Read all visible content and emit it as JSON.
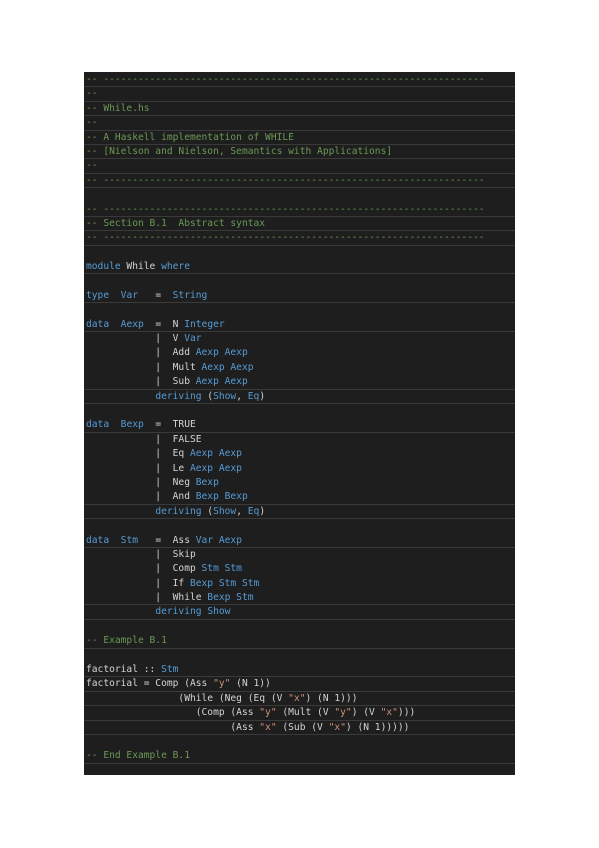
{
  "colors": {
    "background": "#1e1e1e",
    "comment": "#6a9955",
    "keyword": "#569cd6",
    "string": "#ce9178",
    "text": "#d4d4d4"
  },
  "lines": [
    [
      {
        "t": "-- ------------------------------------------------------------------",
        "k": "comment"
      }
    ],
    [
      {
        "t": "--",
        "k": "comment"
      }
    ],
    [
      {
        "t": "-- While.hs",
        "k": "comment"
      }
    ],
    [
      {
        "t": "--",
        "k": "comment"
      }
    ],
    [
      {
        "t": "-- A Haskell implementation of WHILE",
        "k": "comment"
      }
    ],
    [
      {
        "t": "-- [Nielson and Nielson, Semantics with Applications]",
        "k": "comment"
      }
    ],
    [
      {
        "t": "--",
        "k": "comment"
      }
    ],
    [
      {
        "t": "-- ------------------------------------------------------------------",
        "k": "comment"
      }
    ],
    [],
    [
      {
        "t": "-- ------------------------------------------------------------------",
        "k": "comment"
      }
    ],
    [
      {
        "t": "-- Section B.1  Abstract syntax",
        "k": "comment"
      }
    ],
    [
      {
        "t": "-- ------------------------------------------------------------------",
        "k": "comment"
      }
    ],
    [],
    [
      {
        "t": "module",
        "k": "keyword"
      },
      {
        "t": " While ",
        "k": "plain"
      },
      {
        "t": "where",
        "k": "keyword"
      }
    ],
    [],
    [
      {
        "t": "type",
        "k": "keyword"
      },
      {
        "t": "  ",
        "k": "plain"
      },
      {
        "t": "Var",
        "k": "keyword"
      },
      {
        "t": "   =  ",
        "k": "plain"
      },
      {
        "t": "String",
        "k": "keyword"
      }
    ],
    [],
    [
      {
        "t": "data",
        "k": "keyword"
      },
      {
        "t": "  ",
        "k": "plain"
      },
      {
        "t": "Aexp",
        "k": "keyword"
      },
      {
        "t": "  =  N ",
        "k": "plain"
      },
      {
        "t": "Integer",
        "k": "keyword"
      }
    ],
    [
      {
        "t": "            |  V ",
        "k": "plain"
      },
      {
        "t": "Var",
        "k": "keyword"
      }
    ],
    [
      {
        "t": "            |  Add ",
        "k": "plain"
      },
      {
        "t": "Aexp Aexp",
        "k": "keyword"
      }
    ],
    [
      {
        "t": "            |  Mult ",
        "k": "plain"
      },
      {
        "t": "Aexp Aexp",
        "k": "keyword"
      }
    ],
    [
      {
        "t": "            |  Sub ",
        "k": "plain"
      },
      {
        "t": "Aexp Aexp",
        "k": "keyword"
      }
    ],
    [
      {
        "t": "            ",
        "k": "plain"
      },
      {
        "t": "deriving",
        "k": "keyword"
      },
      {
        "t": " (",
        "k": "plain"
      },
      {
        "t": "Show",
        "k": "keyword"
      },
      {
        "t": ", ",
        "k": "plain"
      },
      {
        "t": "Eq",
        "k": "keyword"
      },
      {
        "t": ")",
        "k": "plain"
      }
    ],
    [],
    [
      {
        "t": "data",
        "k": "keyword"
      },
      {
        "t": "  ",
        "k": "plain"
      },
      {
        "t": "Bexp",
        "k": "keyword"
      },
      {
        "t": "  =  TRUE",
        "k": "plain"
      }
    ],
    [
      {
        "t": "            |  FALSE",
        "k": "plain"
      }
    ],
    [
      {
        "t": "            |  Eq ",
        "k": "plain"
      },
      {
        "t": "Aexp Aexp",
        "k": "keyword"
      }
    ],
    [
      {
        "t": "            |  Le ",
        "k": "plain"
      },
      {
        "t": "Aexp Aexp",
        "k": "keyword"
      }
    ],
    [
      {
        "t": "            |  Neg ",
        "k": "plain"
      },
      {
        "t": "Bexp",
        "k": "keyword"
      }
    ],
    [
      {
        "t": "            |  And ",
        "k": "plain"
      },
      {
        "t": "Bexp Bexp",
        "k": "keyword"
      }
    ],
    [
      {
        "t": "            ",
        "k": "plain"
      },
      {
        "t": "deriving",
        "k": "keyword"
      },
      {
        "t": " (",
        "k": "plain"
      },
      {
        "t": "Show",
        "k": "keyword"
      },
      {
        "t": ", ",
        "k": "plain"
      },
      {
        "t": "Eq",
        "k": "keyword"
      },
      {
        "t": ")",
        "k": "plain"
      }
    ],
    [],
    [
      {
        "t": "data",
        "k": "keyword"
      },
      {
        "t": "  ",
        "k": "plain"
      },
      {
        "t": "Stm",
        "k": "keyword"
      },
      {
        "t": "   =  Ass ",
        "k": "plain"
      },
      {
        "t": "Var Aexp",
        "k": "keyword"
      }
    ],
    [
      {
        "t": "            |  Skip",
        "k": "plain"
      }
    ],
    [
      {
        "t": "            |  Comp ",
        "k": "plain"
      },
      {
        "t": "Stm Stm",
        "k": "keyword"
      }
    ],
    [
      {
        "t": "            |  If ",
        "k": "plain"
      },
      {
        "t": "Bexp Stm Stm",
        "k": "keyword"
      }
    ],
    [
      {
        "t": "            |  While ",
        "k": "plain"
      },
      {
        "t": "Bexp Stm",
        "k": "keyword"
      }
    ],
    [
      {
        "t": "            ",
        "k": "plain"
      },
      {
        "t": "deriving",
        "k": "keyword"
      },
      {
        "t": " ",
        "k": "plain"
      },
      {
        "t": "Show",
        "k": "keyword"
      }
    ],
    [],
    [
      {
        "t": "-- Example B.1",
        "k": "comment"
      }
    ],
    [],
    [
      {
        "t": "factorial :: ",
        "k": "plain"
      },
      {
        "t": "Stm",
        "k": "keyword"
      }
    ],
    [
      {
        "t": "factorial = Comp (Ass ",
        "k": "plain"
      },
      {
        "t": "\"y\"",
        "k": "string"
      },
      {
        "t": " (N 1))",
        "k": "plain"
      }
    ],
    [
      {
        "t": "                (While (Neg (Eq (V ",
        "k": "plain"
      },
      {
        "t": "\"x\"",
        "k": "string"
      },
      {
        "t": ") (N 1)))",
        "k": "plain"
      }
    ],
    [
      {
        "t": "                   (Comp (Ass ",
        "k": "plain"
      },
      {
        "t": "\"y\"",
        "k": "string"
      },
      {
        "t": " (Mult (V ",
        "k": "plain"
      },
      {
        "t": "\"y\"",
        "k": "string"
      },
      {
        "t": ") (V ",
        "k": "plain"
      },
      {
        "t": "\"x\"",
        "k": "string"
      },
      {
        "t": ")))",
        "k": "plain"
      }
    ],
    [
      {
        "t": "                         (Ass ",
        "k": "plain"
      },
      {
        "t": "\"x\"",
        "k": "string"
      },
      {
        "t": " (Sub (V ",
        "k": "plain"
      },
      {
        "t": "\"x\"",
        "k": "string"
      },
      {
        "t": ") (N 1)))))",
        "k": "plain"
      }
    ],
    [],
    [
      {
        "t": "-- End Example B.1",
        "k": "comment"
      }
    ]
  ]
}
